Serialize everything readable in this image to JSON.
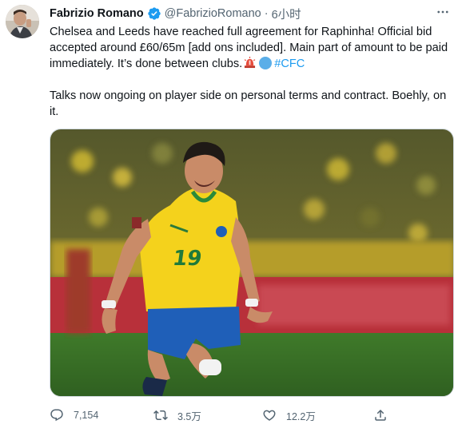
{
  "tweet": {
    "author_name": "Fabrizio Romano",
    "handle": "@FabrizioRomano",
    "separator": "·",
    "time": "6小时",
    "text_line1": "Chelsea and Leeds have reached full agreement for Raphinha! Official bid accepted around £60/65m [add ons included]. Main part of amount to be paid immediately. It’s done between clubs.",
    "hashtag": "#CFC",
    "text_line2": "Talks now ongoing on player side on personal terms and contract. Boehly, on it.",
    "media_alt_icon": "photo-of-footballer-in-brazil-kit",
    "jersey_number": "19"
  },
  "actions": {
    "reply_count": "7,154",
    "retweet_count": "3.5万",
    "like_count": "12.2万"
  },
  "colors": {
    "accent": "#1d9bf0",
    "secondary_text": "#536471"
  },
  "icons": [
    "verified-badge-icon",
    "more-options-icon",
    "siren-emoji-icon",
    "blue-circle-emoji-icon",
    "reply-icon",
    "retweet-icon",
    "like-icon",
    "share-icon"
  ]
}
